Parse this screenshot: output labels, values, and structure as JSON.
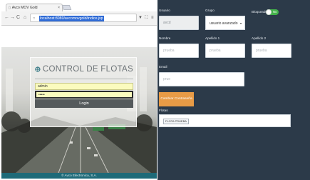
{
  "browser": {
    "tab_title": "Avco MOV Gold",
    "tab_close": "×",
    "url": "localhost:8080/avcomovgold/indice.jsp",
    "nav": {
      "back": "←",
      "forward": "→",
      "reload": "C",
      "home": "⌂"
    },
    "toolbar_icons": {
      "filter": "▼",
      "cart": "⛶",
      "menu": "≡"
    }
  },
  "login": {
    "brand": "CONTROL DE FLOTAS",
    "username_value": "admin",
    "password_value": "•••••",
    "login_label": "Login"
  },
  "footer": {
    "text": "© Avco Electronica, S.A."
  },
  "form": {
    "usuario": {
      "label": "Usuario",
      "value": "avcd"
    },
    "grupo": {
      "label": "Grupo",
      "value": "usuario avanzado"
    },
    "bloqueado": {
      "label": "Bloqueado",
      "toggle_text": "No"
    },
    "nombre": {
      "label": "Nombre",
      "placeholder": "prueba"
    },
    "apellido1": {
      "label": "Apellido 1",
      "placeholder": "prueba"
    },
    "apellido2": {
      "label": "Apellido 2",
      "placeholder": "prueba"
    },
    "email": {
      "label": "Email",
      "placeholder": "prue"
    },
    "change_password_label": "Cambiar Contraseña",
    "flotas": {
      "label": "Flotas",
      "chip": "FLOTA PRUEBA"
    }
  },
  "colors": {
    "panel_bg": "#2c3a49",
    "accent_orange": "#e89b46",
    "toggle_green": "#43b24a",
    "footer_teal": "#1e6a78",
    "field_yellow": "#fbfbbe",
    "url_highlight": "#2f6bd6"
  }
}
